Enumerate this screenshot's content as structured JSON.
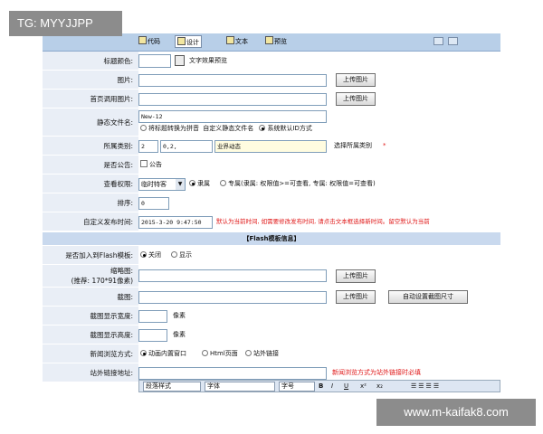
{
  "watermark": {
    "top": "TG: MYYJJPP",
    "bottom": "www.m-kaifak8.com"
  },
  "tabs": {
    "code": "代码",
    "design": "设计",
    "text": "文本",
    "preview": "预览"
  },
  "rows": {
    "title_color": {
      "label": "标题颜色:",
      "preview": "文字效果预览"
    },
    "image": {
      "label": "图片:",
      "upload": "上传图片"
    },
    "home_image": {
      "label": "首页调用图片:",
      "upload": "上传图片"
    },
    "static_name": {
      "label": "静态文件名:",
      "value": "New-12",
      "opt1": "将标题转换为拼音",
      "opt2": "自定义静态文件名",
      "opt3": "系统默认ID方式"
    },
    "category": {
      "label": "所属类别:",
      "id": "2",
      "path": "0,2,",
      "name": "业界动态",
      "link": "选择所属类别",
      "required": "*"
    },
    "announcement": {
      "label": "是否公告:",
      "option": "公告"
    },
    "permission": {
      "label": "查看权限:",
      "select": "临时特客",
      "opt1": "隶属",
      "opt2": "专属(隶属: 权限值>=可查看, 专属: 权限值=可查看)"
    },
    "sort": {
      "label": "排序:",
      "value": "0"
    },
    "publish_time": {
      "label": "自定义发布时间:",
      "value": "2015-3-20 9:47:50",
      "hint": "默认为当前时间, 如需要修改发布时间, 请点击文本框选择新时间。留空默认为当前"
    },
    "flash_header": "【Flash模板信息】",
    "flash_join": {
      "label": "是否加入到Flash模板:",
      "off": "关闭",
      "on": "显示"
    },
    "thumb": {
      "label": "缩略图:",
      "sublabel": "(推荐: 170*91像素)",
      "upload": "上传图片"
    },
    "cut_image": {
      "label": "截图:",
      "upload": "上传图片",
      "auto": "自动设置截图尺寸"
    },
    "cut_width": {
      "label": "截图显示宽度:",
      "unit": "像素"
    },
    "cut_height": {
      "label": "截图显示高度:",
      "unit": "像素"
    },
    "browse_mode": {
      "label": "新闻浏览方式:",
      "opt1": "动画内置窗口",
      "opt2": "Html页面",
      "opt3": "站外链接"
    },
    "external_link": {
      "label": "站外链接地址:",
      "hint": "新闻浏览方式为站外链接时必填"
    }
  },
  "editor": {
    "style": "段落样式",
    "font": "字体",
    "size": "字号",
    "bold": "B",
    "italic": "I",
    "underline": "U",
    "sup": "x²",
    "sub": "x₂"
  }
}
